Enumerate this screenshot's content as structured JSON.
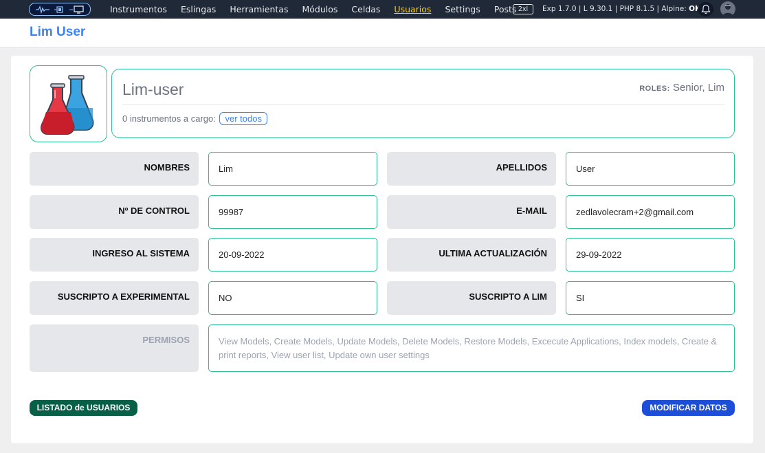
{
  "nav": {
    "links": [
      "Instrumentos",
      "Eslingas",
      "Herramientas",
      "Módulos",
      "Celdas",
      "Usuarios",
      "Settings",
      "Posts"
    ],
    "active_index": 5,
    "breakpoint_badge": "2xl",
    "version_prefix": "Exp 1.7.0 | L 9.30.1 | PHP 8.1.5 | Alpine: ",
    "alpine_status": "OK",
    "logo_icons": [
      "signal-icon",
      "chip-icon",
      "monitor-icon"
    ],
    "active_color": "#facc15"
  },
  "header": {
    "title": "Lim User"
  },
  "profile": {
    "image_icon": "flasks-icon",
    "username": "Lim-user",
    "roles_label": "ROLES:",
    "roles_value": "Senior, Lim",
    "instruments_text": "0 instrumentos a cargo:",
    "view_all_label": "ver todos"
  },
  "fields": {
    "nombres_label": "NOMBRES",
    "nombres_value": "Lim",
    "apellidos_label": "APELLIDOS",
    "apellidos_value": "User",
    "control_label": "Nº DE CONTROL",
    "control_value": "99987",
    "email_label": "E-MAIL",
    "email_value": "zedlavolecram+2@gmail.com",
    "ingreso_label": "INGRESO AL SISTEMA",
    "ingreso_value": "20-09-2022",
    "actualizacion_label": "ULTIMA ACTUALIZACIÓN",
    "actualizacion_value": "29-09-2022",
    "exp_label": "SUSCRIPTO A EXPERIMENTAL",
    "exp_value": "NO",
    "lim_label": "SUSCRIPTO A LIM",
    "lim_value": "SI",
    "permisos_label": "PERMISOS",
    "permisos_value": "View Models, Create Models, Update Models, Delete Models, Restore Models, Excecute Applications, Index models, Create & print reports, View user list, Update own user settings"
  },
  "buttons": {
    "list_users": "LISTADO de USUARIOS",
    "modify": "MODIFICAR DATOS"
  },
  "colors": {
    "title_blue": "#3b82f6",
    "border_green": "#2dbf95",
    "list_btn": "#065f46",
    "modify_btn": "#1d4ed8"
  }
}
